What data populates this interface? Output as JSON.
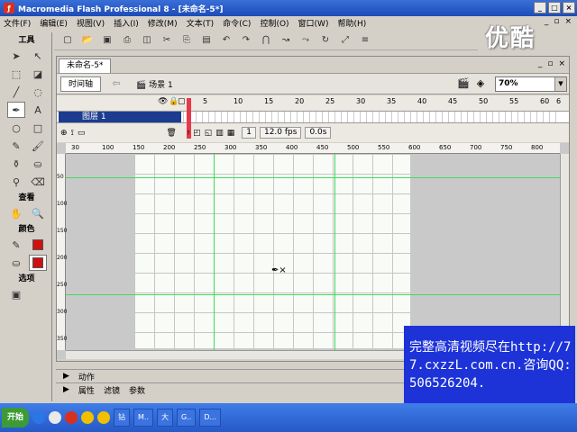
{
  "window": {
    "title": "Macromedia Flash Professional 8 - [未命名-5*]",
    "app_icon": "flash-logo"
  },
  "menu": [
    "文件(F)",
    "编辑(E)",
    "视图(V)",
    "插入(I)",
    "修改(M)",
    "文本(T)",
    "命令(C)",
    "控制(O)",
    "窗口(W)",
    "帮助(H)"
  ],
  "watermark": "优酷",
  "tools": {
    "title": "工具",
    "view_title": "查看",
    "color_title": "颜色",
    "options_title": "选项",
    "text_tool": "A"
  },
  "document": {
    "tab": "未命名-5*",
    "timeline_button": "时间轴",
    "scene": "场景 1",
    "zoom": "70%",
    "frame_numbers": [
      "5",
      "10",
      "15",
      "20",
      "25",
      "30",
      "35",
      "40",
      "45",
      "50",
      "55",
      "60",
      "6"
    ],
    "layer": "图层 1",
    "current_frame": "1",
    "fps": "12.0 fps",
    "time": "0.0s",
    "ruler_ticks": [
      "30",
      "100",
      "150",
      "200",
      "250",
      "300",
      "350",
      "400",
      "450",
      "500",
      "550",
      "600",
      "650",
      "700",
      "750",
      "800"
    ],
    "vruler_ticks": [
      "50",
      "100",
      "150",
      "200",
      "250",
      "300",
      "350"
    ]
  },
  "panels": {
    "actions": "动作",
    "properties": "属性",
    "filters": "滤镜",
    "parameters": "参数"
  },
  "ad_text": "完整高清视频尽在http://77.cxzzL.com.cn.咨询QQ: 506526204.",
  "taskbar": {
    "start": "开始",
    "tasks": [
      "钻",
      "M..",
      "大",
      "G..",
      "D..."
    ]
  },
  "colors": {
    "stage": "#f8fbf6",
    "grid": "#c6c6c6",
    "guide": "#3fdc5b",
    "ad_bg": "#1d33d8",
    "selected_layer": "#1c3c90",
    "playhead": "#e8394a"
  }
}
